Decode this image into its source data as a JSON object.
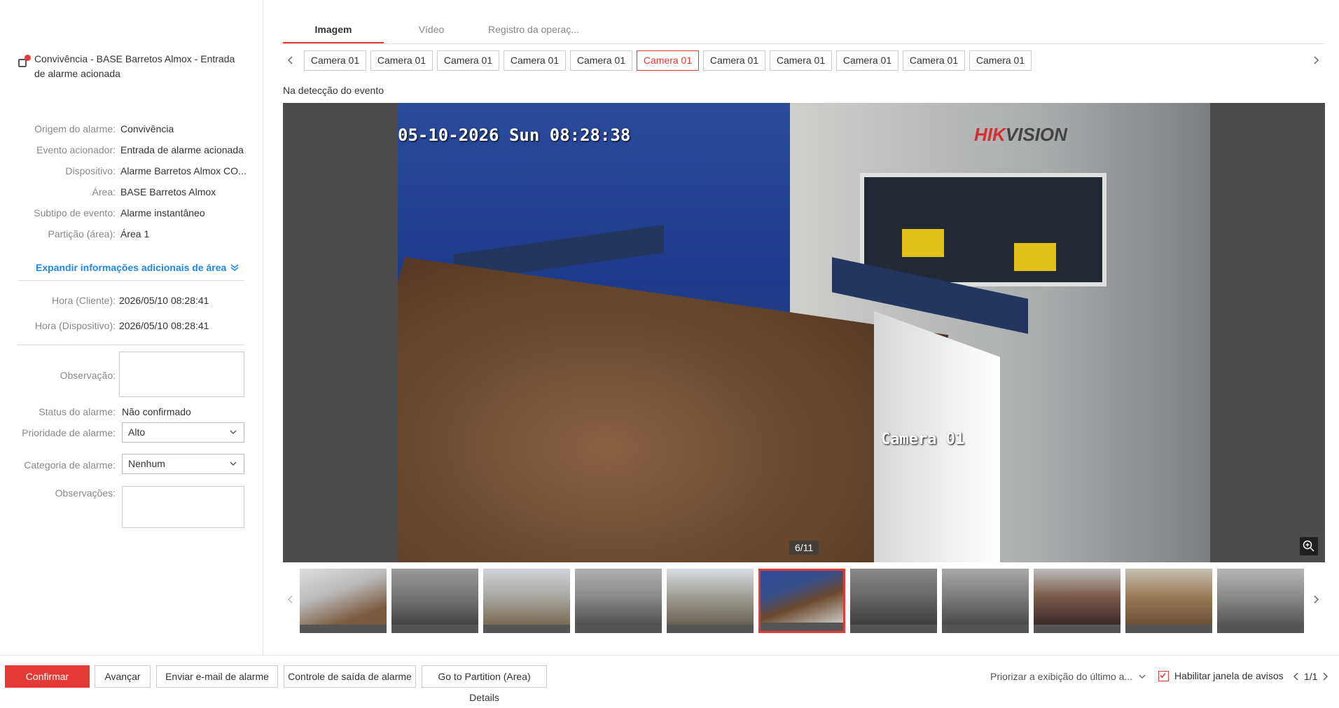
{
  "alarm": {
    "title": "Convivência - BASE Barretos Almox - Entrada de alarme acionada"
  },
  "details": [
    {
      "label": "Origem do alarme:",
      "value": "Convivência"
    },
    {
      "label": "Evento acionador:",
      "value": "Entrada de alarme acionada"
    },
    {
      "label": "Dispositivo:",
      "value": "Alarme Barretos Almox CO..."
    },
    {
      "label": "Área:",
      "value": "BASE Barretos Almox"
    },
    {
      "label": "Subtipo de evento:",
      "value": "Alarme instantâneo"
    },
    {
      "label": "Partição (área):",
      "value": "Área 1"
    }
  ],
  "expand_label": "Expandir informações adicionais de área",
  "times": [
    {
      "label": "Hora (Cliente):",
      "value": "2026/05/10 08:28:41"
    },
    {
      "label": "Hora (Dispositivo):",
      "value": "2026/05/10 08:28:41"
    }
  ],
  "form": {
    "observacao_label": "Observação:",
    "status_label": "Status do alarme:",
    "status_value": "Não confirmado",
    "priority_label": "Prioridade de alarme:",
    "priority_value": "Alto",
    "category_label": "Categoria de alarme:",
    "category_value": "Nenhum",
    "observacoes_label": "Observações:"
  },
  "tabs": [
    {
      "label": "Imagem",
      "active": true
    },
    {
      "label": "Vídeo",
      "active": false
    },
    {
      "label": "Registro da operaç...",
      "active": false
    }
  ],
  "cameras": [
    "Camera 01",
    "Camera 01",
    "Camera 01",
    "Camera 01",
    "Camera 01",
    "Camera 01",
    "Camera 01",
    "Camera 01",
    "Camera 01",
    "Camera 01",
    "Camera 01"
  ],
  "active_camera_index": 5,
  "event_label": "Na detecção do evento",
  "viewer": {
    "timestamp": "05-10-2026 Sun 08:28:38",
    "brand_red": "HIK",
    "brand_gray": "VISION",
    "camera_name": "Camera 01",
    "counter": "6/11"
  },
  "thumbnails_count": 11,
  "active_thumbnail_index": 5,
  "footer": {
    "confirm": "Confirmar",
    "next": "Avançar",
    "email": "Enviar e-mail de alarme",
    "output": "Controle de saída de alarme",
    "partition": "Go to Partition (Area) Details",
    "priority_display": "Priorizar a exibição do último a...",
    "enable_popup": "Habilitar janela de avisos",
    "page": "1/1"
  },
  "colors": {
    "accent": "#e53935",
    "link": "#1e88e5"
  }
}
